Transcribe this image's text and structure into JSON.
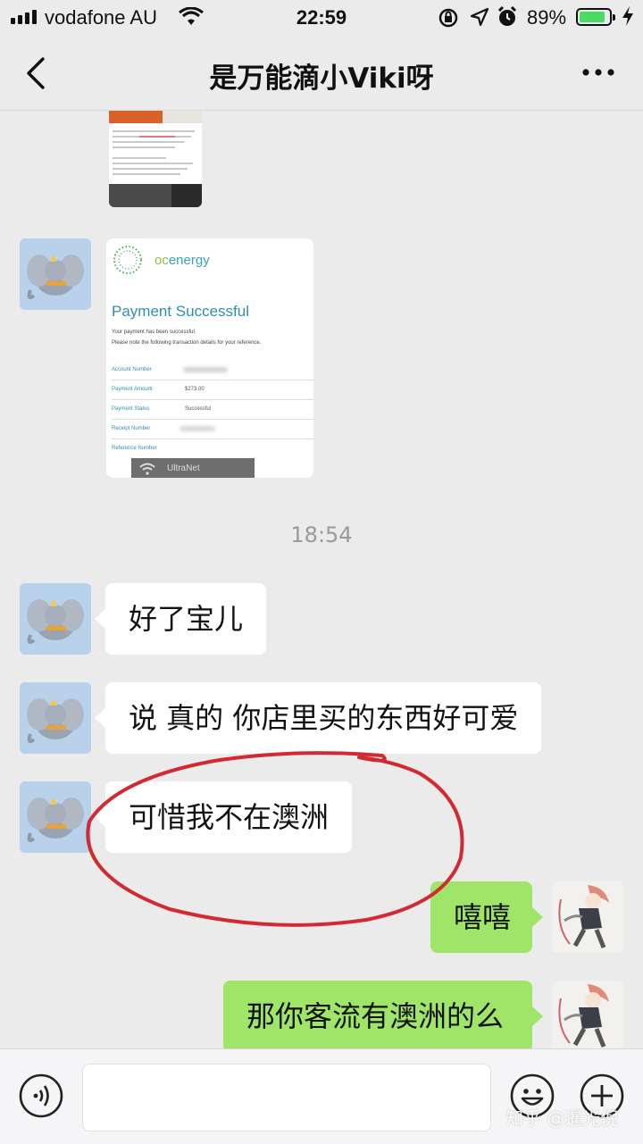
{
  "status_bar": {
    "carrier": "vodafone AU",
    "time": "22:59",
    "battery_percent": "89%",
    "battery_level": 0.89,
    "icons": [
      "signal-icon",
      "wifi-icon",
      "rotation-lock-icon",
      "location-icon",
      "alarm-icon",
      "battery-icon",
      "charging-icon"
    ]
  },
  "header": {
    "title": "是万能滴小Viki呀",
    "back_icon": "chevron-left-icon",
    "more_icon": "more-dots-icon"
  },
  "messages": {
    "timestamp": "18:54",
    "payment_card": {
      "brand": "energy",
      "brand_prefix": "oc",
      "headline": "Payment Successful",
      "line1": "Your payment has been successful.",
      "line2": "Please note the following transaction details for your reference.",
      "rows": [
        {
          "label": "Account Number",
          "value": ""
        },
        {
          "label": "Payment Amount",
          "value": "$273.00"
        },
        {
          "label": "Payment Status",
          "value": "Successful"
        },
        {
          "label": "Receipt Number",
          "value": ""
        },
        {
          "label": "Reference Number",
          "value": ""
        }
      ],
      "overlay_text": "UltraNet"
    },
    "left": [
      {
        "text": "好了宝儿"
      },
      {
        "text": "说 真的 你店里买的东西好可爱"
      },
      {
        "text": "可惜我不在澳洲"
      }
    ],
    "right": [
      {
        "text": "嘻嘻"
      },
      {
        "text": "那你客流有澳洲的么"
      }
    ]
  },
  "input_bar": {
    "voice_icon": "voice-icon",
    "emoji_icon": "emoji-icon",
    "plus_icon": "plus-icon",
    "text_value": ""
  },
  "watermark": "知乎 @暹光倪",
  "colors": {
    "background": "#ebebeb",
    "bubble_mine": "#9fe56a",
    "bubble_other": "#ffffff",
    "annotation_circle": "#d22a33"
  }
}
